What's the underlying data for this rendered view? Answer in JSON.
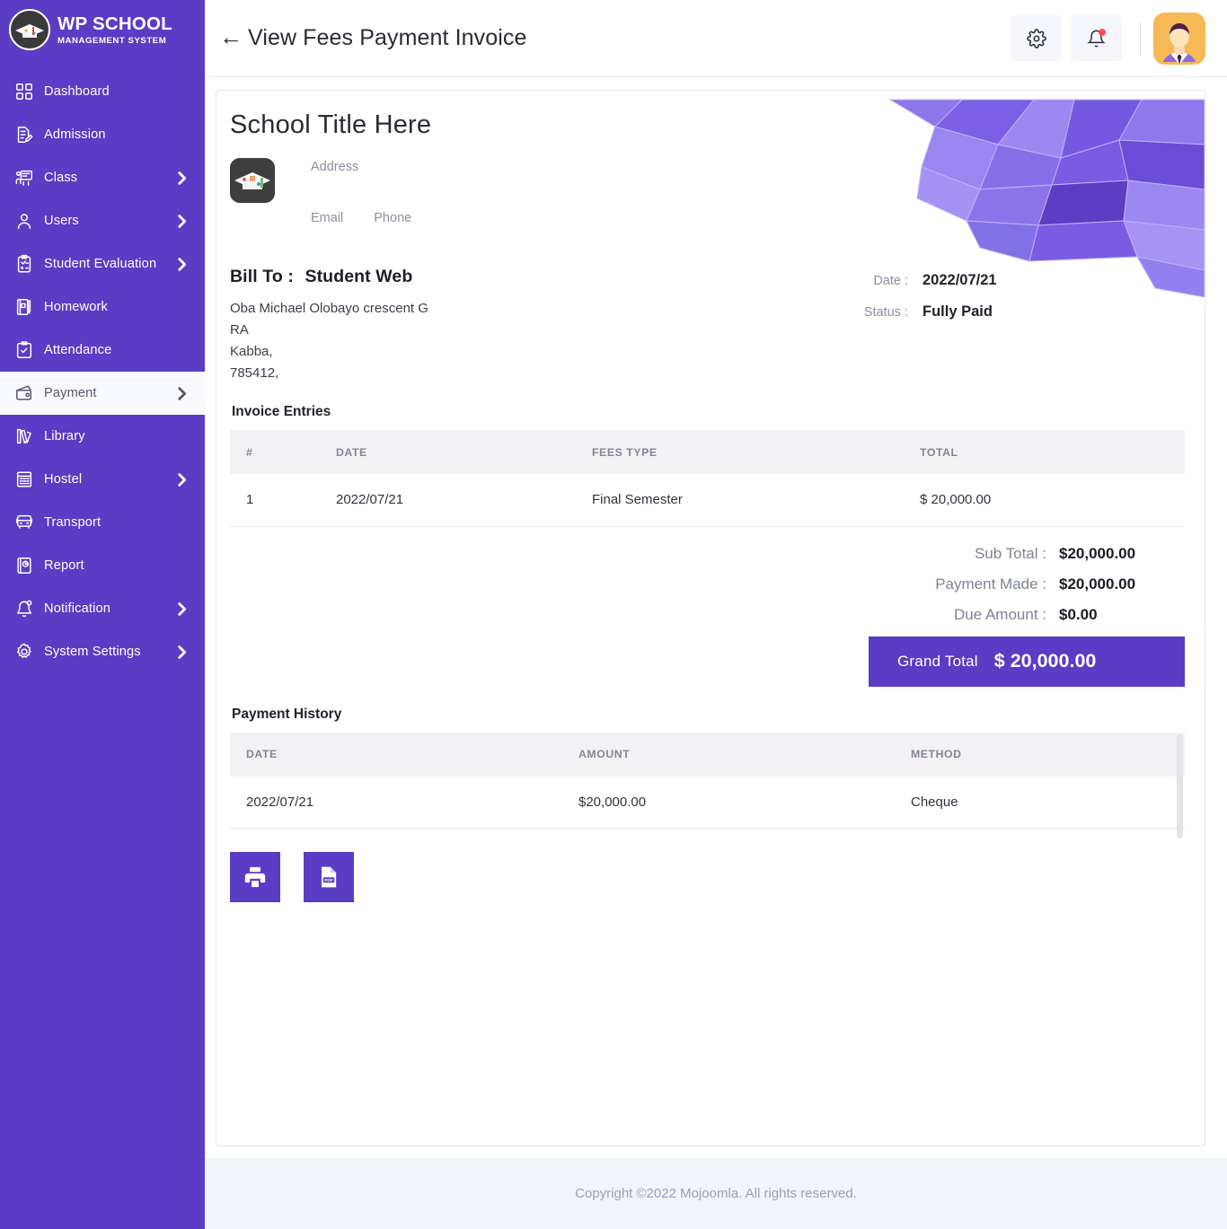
{
  "brand": {
    "title": "WP SCHOOL",
    "subtitle": "MANAGEMENT SYSTEM",
    "logo_icon": "graduation-cap-logo"
  },
  "sidebar": {
    "accent_color": "#5b3cc4",
    "active_bg": "#f8f9fe",
    "items": [
      {
        "label": "Dashboard",
        "icon": "grid-icon",
        "caret": false,
        "active": false
      },
      {
        "label": "Admission",
        "icon": "document-edit-icon",
        "caret": false,
        "active": false
      },
      {
        "label": "Class",
        "icon": "classroom-icon",
        "caret": true,
        "active": false
      },
      {
        "label": "Users",
        "icon": "user-icon",
        "caret": true,
        "active": false
      },
      {
        "label": "Student Evaluation",
        "icon": "clipboard-check-icon",
        "caret": true,
        "active": false
      },
      {
        "label": "Homework",
        "icon": "book-pen-icon",
        "caret": false,
        "active": false
      },
      {
        "label": "Attendance",
        "icon": "checklist-icon",
        "caret": false,
        "active": false
      },
      {
        "label": "Payment",
        "icon": "wallet-icon",
        "caret": true,
        "active": true
      },
      {
        "label": "Library",
        "icon": "books-icon",
        "caret": false,
        "active": false
      },
      {
        "label": "Hostel",
        "icon": "building-icon",
        "caret": true,
        "active": false
      },
      {
        "label": "Transport",
        "icon": "bus-icon",
        "caret": false,
        "active": false
      },
      {
        "label": "Report",
        "icon": "report-icon",
        "caret": false,
        "active": false
      },
      {
        "label": "Notification",
        "icon": "bell-icon",
        "caret": true,
        "active": false
      },
      {
        "label": "System Settings",
        "icon": "gear-icon",
        "caret": true,
        "active": false
      }
    ]
  },
  "topbar": {
    "back_icon": "back-arrow-icon",
    "title": "View Fees Payment Invoice",
    "settings_icon": "gear-icon",
    "notifications_icon": "bell-icon",
    "has_notification_dot": true,
    "avatar_icon": "user-avatar"
  },
  "invoice": {
    "school_title": "School Title Here",
    "org_logo_icon": "school-logo",
    "address_label": "Address",
    "email_label": "Email",
    "phone_label": "Phone",
    "bill_to_label": "Bill To :",
    "bill_to_name": "Student Web",
    "bill_to_address_lines": [
      "Oba Michael Olobayo crescent G",
      "RA",
      "Kabba,",
      "785412,"
    ],
    "date_label": "Date :",
    "date_value": "2022/07/21",
    "status_label": "Status :",
    "status_value": "Fully Paid",
    "entries_heading": "Invoice Entries",
    "entries_columns": [
      "#",
      "DATE",
      "FEES TYPE",
      "TOTAL"
    ],
    "entries_rows": [
      [
        "1",
        "2022/07/21",
        "Final Semester",
        "$ 20,000.00"
      ]
    ],
    "totals": [
      {
        "label": "Sub Total :",
        "value": "$20,000.00"
      },
      {
        "label": "Payment Made :",
        "value": "$20,000.00"
      },
      {
        "label": "Due Amount :",
        "value": "$0.00"
      }
    ],
    "grand_total_label": "Grand Total",
    "grand_total_value": "$ 20,000.00",
    "grand_total_color": "#5b3cc4",
    "history_heading": "Payment History",
    "history_columns": [
      "DATE",
      "AMOUNT",
      "METHOD"
    ],
    "history_rows": [
      [
        "2022/07/21",
        "$20,000.00",
        "Cheque"
      ]
    ],
    "print_icon": "printer-icon",
    "pdf_icon": "pdf-file-icon"
  },
  "footer": {
    "text": "Copyright ©2022 Mojoomla. All rights reserved."
  }
}
